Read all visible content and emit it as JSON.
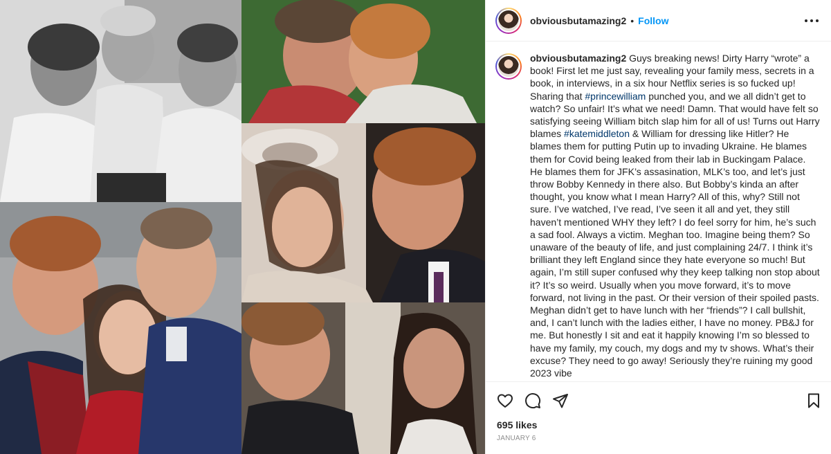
{
  "post": {
    "username": "obviousbutamazing2",
    "separator": "•",
    "follow_label": "Follow",
    "more_icon": "more-options-icon"
  },
  "caption": {
    "username": "obviousbutamazing2",
    "seg1": " Guys breaking news! Dirty Harry “wrote” a book! First let me just say, revealing your family mess, secrets in a book, in interviews, in a six hour Netflix series is so fucked up! Sharing that ",
    "tag1": "#princewilliam",
    "seg2": " punched you, and we all didn’t get to watch? So unfair! It’s what we need! Damn. That would have felt so satisfying seeing William bitch slap him for all of us! Turns out Harry blames ",
    "tag2": "#katemiddleton",
    "seg3": " & William for dressing like Hitler? He blames them for putting Putin up to invading Ukraine. He blames them for Covid being leaked from their lab in Buckingam Palace. He blames them for JFK’s assasination, MLK’s too, and let’s just throw Bobby Kennedy in there also. But Bobby’s kinda an after thought, you know what I mean Harry? All of this, why? Still not sure. I’ve watched, I’ve read, I’ve seen it all and yet, they still haven’t mentioned WHY they left? I do feel sorry for him, he’s such a sad fool. Always a victim. Meghan too. Imagine being them? So unaware of the beauty of life, and just complaining 24/7. I think it’s brilliant they left England since they hate everyone so much! But again, I’m still super confused why they keep talking non stop about it? It’s so weird. Usually when you move forward, it’s to move forward, not living in the past. Or their version of their spoiled pasts. Meghan didn’t get to have lunch with her “friends”? I call bullshit, and, I can’t lunch with the ladies either, I have no money. PB&J for me. But honestly I sit and eat it happily knowing I’m so blessed to have my family, my couch, my dogs and my tv shows. What’s their excuse? They need to go away! Seriously they’re ruining my good 2023 vibe"
  },
  "actions": {
    "like_icon": "heart-icon",
    "comment_icon": "comment-icon",
    "share_icon": "share-icon",
    "save_icon": "bookmark-icon"
  },
  "stats": {
    "likes": "695 likes",
    "date": "January 6"
  },
  "colors": {
    "link": "#0095f6",
    "hashtag": "#00376b",
    "text": "#262626",
    "muted": "#8e8e8e"
  }
}
